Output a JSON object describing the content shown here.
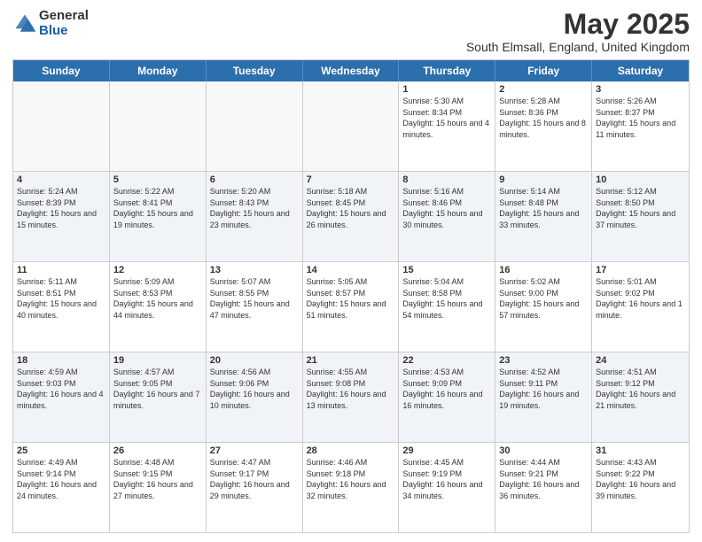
{
  "logo": {
    "general": "General",
    "blue": "Blue"
  },
  "title": "May 2025",
  "subtitle": "South Elmsall, England, United Kingdom",
  "headers": [
    "Sunday",
    "Monday",
    "Tuesday",
    "Wednesday",
    "Thursday",
    "Friday",
    "Saturday"
  ],
  "rows": [
    [
      {
        "day": "",
        "info": "",
        "empty": true
      },
      {
        "day": "",
        "info": "",
        "empty": true
      },
      {
        "day": "",
        "info": "",
        "empty": true
      },
      {
        "day": "",
        "info": "",
        "empty": true
      },
      {
        "day": "1",
        "info": "Sunrise: 5:30 AM\nSunset: 8:34 PM\nDaylight: 15 hours\nand 4 minutes.",
        "empty": false
      },
      {
        "day": "2",
        "info": "Sunrise: 5:28 AM\nSunset: 8:36 PM\nDaylight: 15 hours\nand 8 minutes.",
        "empty": false
      },
      {
        "day": "3",
        "info": "Sunrise: 5:26 AM\nSunset: 8:37 PM\nDaylight: 15 hours\nand 11 minutes.",
        "empty": false
      }
    ],
    [
      {
        "day": "4",
        "info": "Sunrise: 5:24 AM\nSunset: 8:39 PM\nDaylight: 15 hours\nand 15 minutes.",
        "empty": false
      },
      {
        "day": "5",
        "info": "Sunrise: 5:22 AM\nSunset: 8:41 PM\nDaylight: 15 hours\nand 19 minutes.",
        "empty": false
      },
      {
        "day": "6",
        "info": "Sunrise: 5:20 AM\nSunset: 8:43 PM\nDaylight: 15 hours\nand 23 minutes.",
        "empty": false
      },
      {
        "day": "7",
        "info": "Sunrise: 5:18 AM\nSunset: 8:45 PM\nDaylight: 15 hours\nand 26 minutes.",
        "empty": false
      },
      {
        "day": "8",
        "info": "Sunrise: 5:16 AM\nSunset: 8:46 PM\nDaylight: 15 hours\nand 30 minutes.",
        "empty": false
      },
      {
        "day": "9",
        "info": "Sunrise: 5:14 AM\nSunset: 8:48 PM\nDaylight: 15 hours\nand 33 minutes.",
        "empty": false
      },
      {
        "day": "10",
        "info": "Sunrise: 5:12 AM\nSunset: 8:50 PM\nDaylight: 15 hours\nand 37 minutes.",
        "empty": false
      }
    ],
    [
      {
        "day": "11",
        "info": "Sunrise: 5:11 AM\nSunset: 8:51 PM\nDaylight: 15 hours\nand 40 minutes.",
        "empty": false
      },
      {
        "day": "12",
        "info": "Sunrise: 5:09 AM\nSunset: 8:53 PM\nDaylight: 15 hours\nand 44 minutes.",
        "empty": false
      },
      {
        "day": "13",
        "info": "Sunrise: 5:07 AM\nSunset: 8:55 PM\nDaylight: 15 hours\nand 47 minutes.",
        "empty": false
      },
      {
        "day": "14",
        "info": "Sunrise: 5:05 AM\nSunset: 8:57 PM\nDaylight: 15 hours\nand 51 minutes.",
        "empty": false
      },
      {
        "day": "15",
        "info": "Sunrise: 5:04 AM\nSunset: 8:58 PM\nDaylight: 15 hours\nand 54 minutes.",
        "empty": false
      },
      {
        "day": "16",
        "info": "Sunrise: 5:02 AM\nSunset: 9:00 PM\nDaylight: 15 hours\nand 57 minutes.",
        "empty": false
      },
      {
        "day": "17",
        "info": "Sunrise: 5:01 AM\nSunset: 9:02 PM\nDaylight: 16 hours\nand 1 minute.",
        "empty": false
      }
    ],
    [
      {
        "day": "18",
        "info": "Sunrise: 4:59 AM\nSunset: 9:03 PM\nDaylight: 16 hours\nand 4 minutes.",
        "empty": false
      },
      {
        "day": "19",
        "info": "Sunrise: 4:57 AM\nSunset: 9:05 PM\nDaylight: 16 hours\nand 7 minutes.",
        "empty": false
      },
      {
        "day": "20",
        "info": "Sunrise: 4:56 AM\nSunset: 9:06 PM\nDaylight: 16 hours\nand 10 minutes.",
        "empty": false
      },
      {
        "day": "21",
        "info": "Sunrise: 4:55 AM\nSunset: 9:08 PM\nDaylight: 16 hours\nand 13 minutes.",
        "empty": false
      },
      {
        "day": "22",
        "info": "Sunrise: 4:53 AM\nSunset: 9:09 PM\nDaylight: 16 hours\nand 16 minutes.",
        "empty": false
      },
      {
        "day": "23",
        "info": "Sunrise: 4:52 AM\nSunset: 9:11 PM\nDaylight: 16 hours\nand 19 minutes.",
        "empty": false
      },
      {
        "day": "24",
        "info": "Sunrise: 4:51 AM\nSunset: 9:12 PM\nDaylight: 16 hours\nand 21 minutes.",
        "empty": false
      }
    ],
    [
      {
        "day": "25",
        "info": "Sunrise: 4:49 AM\nSunset: 9:14 PM\nDaylight: 16 hours\nand 24 minutes.",
        "empty": false
      },
      {
        "day": "26",
        "info": "Sunrise: 4:48 AM\nSunset: 9:15 PM\nDaylight: 16 hours\nand 27 minutes.",
        "empty": false
      },
      {
        "day": "27",
        "info": "Sunrise: 4:47 AM\nSunset: 9:17 PM\nDaylight: 16 hours\nand 29 minutes.",
        "empty": false
      },
      {
        "day": "28",
        "info": "Sunrise: 4:46 AM\nSunset: 9:18 PM\nDaylight: 16 hours\nand 32 minutes.",
        "empty": false
      },
      {
        "day": "29",
        "info": "Sunrise: 4:45 AM\nSunset: 9:19 PM\nDaylight: 16 hours\nand 34 minutes.",
        "empty": false
      },
      {
        "day": "30",
        "info": "Sunrise: 4:44 AM\nSunset: 9:21 PM\nDaylight: 16 hours\nand 36 minutes.",
        "empty": false
      },
      {
        "day": "31",
        "info": "Sunrise: 4:43 AM\nSunset: 9:22 PM\nDaylight: 16 hours\nand 39 minutes.",
        "empty": false
      }
    ]
  ]
}
